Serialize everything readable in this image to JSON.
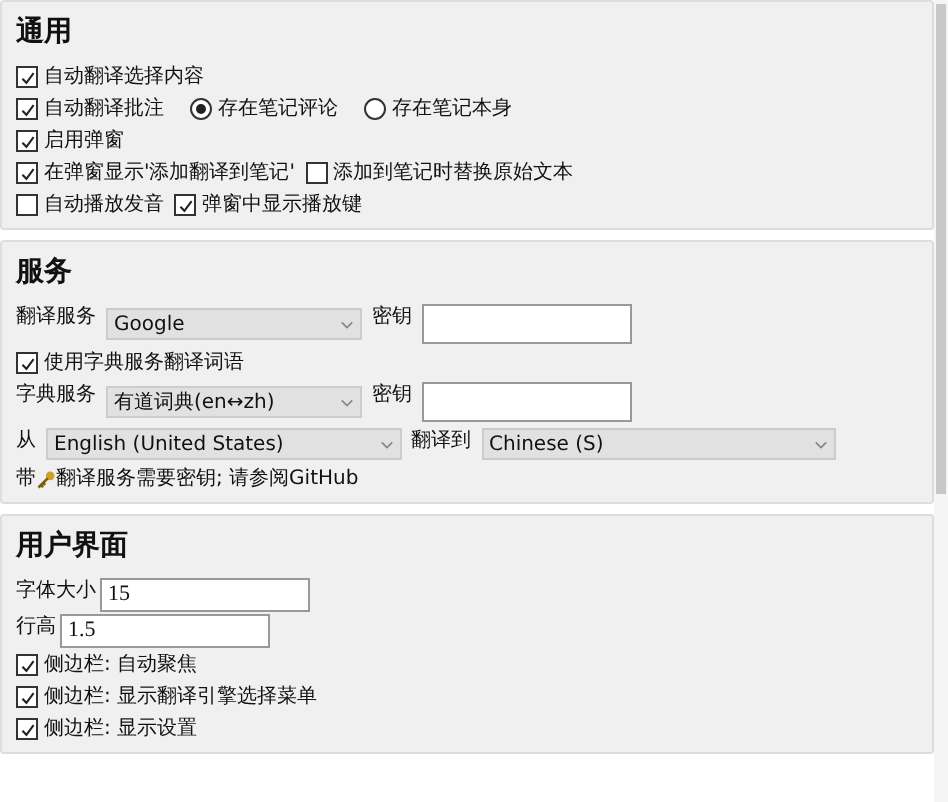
{
  "sections": [
    {
      "title": "通用",
      "rows": [
        [
          {
            "kind": "checkbox",
            "label": "自动翻译选择内容",
            "checked": true
          }
        ],
        [
          {
            "kind": "checkbox",
            "label": "自动翻译批注",
            "checked": true
          },
          {
            "kind": "radio",
            "label": "存在笔记评论",
            "selected": true
          },
          {
            "kind": "radio",
            "label": "存在笔记本身",
            "selected": false
          }
        ],
        [
          {
            "kind": "checkbox",
            "label": "启用弹窗",
            "checked": true
          }
        ],
        [
          {
            "kind": "checkbox",
            "label": "在弹窗显示'添加翻译到笔记'",
            "checked": true
          },
          {
            "kind": "checkbox",
            "label": "添加到笔记时替换原始文本",
            "checked": false
          }
        ],
        [
          {
            "kind": "checkbox",
            "label": "自动播放发音",
            "checked": false
          },
          {
            "kind": "checkbox",
            "label": "弹窗中显示播放键",
            "checked": true
          }
        ]
      ]
    },
    {
      "title": "服务",
      "rows": [
        [
          {
            "kind": "label",
            "label": "翻译服务"
          },
          {
            "kind": "select",
            "value": "Google"
          },
          {
            "kind": "label",
            "label": "密钥"
          },
          {
            "kind": "input"
          }
        ],
        [
          {
            "kind": "checkbox",
            "label": "使用字典服务翻译词语",
            "checked": true
          }
        ],
        [
          {
            "kind": "label",
            "label": "字典服务"
          },
          {
            "kind": "select",
            "value": "有道词典(en↔zh)"
          },
          {
            "kind": "label",
            "label": "密钥"
          },
          {
            "kind": "input"
          }
        ],
        [
          {
            "kind": "label",
            "label": "从"
          },
          {
            "kind": "select",
            "value": "English (United States)"
          },
          {
            "kind": "label",
            "label": "翻译到"
          },
          {
            "kind": "select",
            "value": "Chinese (S)"
          }
        ],
        [
          {
            "kind": "note",
            "before": "带",
            "after": "翻译服务需要密钥; 请参阅GitHub"
          }
        ]
      ]
    },
    {
      "title": "用户界面",
      "fields": [
        {
          "label": "字体大小",
          "value": "15"
        },
        {
          "label": "行高",
          "value": "1.5"
        }
      ],
      "rows": [
        [
          {
            "kind": "checkbox",
            "label": "侧边栏: 自动聚焦",
            "checked": true
          }
        ],
        [
          {
            "kind": "checkbox",
            "label": "侧边栏: 显示翻译引擎选择菜单",
            "checked": true
          }
        ],
        [
          {
            "kind": "checkbox",
            "label": "侧边栏: 显示设置",
            "checked": true
          }
        ]
      ]
    }
  ]
}
